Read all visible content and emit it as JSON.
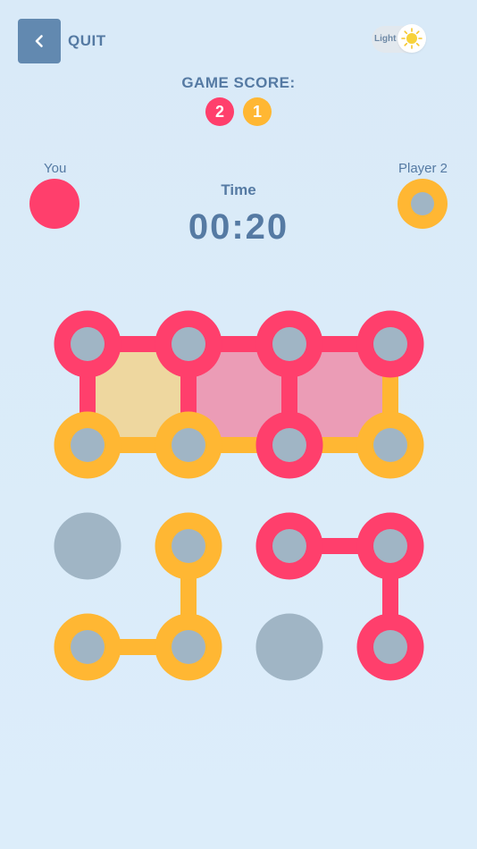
{
  "header": {
    "back_icon": "chevron-left-icon",
    "quit_label": "QUIT",
    "theme_label": "Light",
    "theme_icon": "sun-icon"
  },
  "score": {
    "title": "GAME SCORE:",
    "player1": "2",
    "player2": "1"
  },
  "players": {
    "you": {
      "name": "You",
      "color": "#ff3f6c"
    },
    "opponent": {
      "name": "Player 2",
      "color": "#ffb733"
    }
  },
  "timer": {
    "label": "Time",
    "value": "00:20"
  },
  "colors": {
    "background": "#dcecf9",
    "accent": "#557aa3",
    "player1": "#ff3f6c",
    "player2": "#ffb733",
    "dot_empty": "#a0b5c5",
    "box_player1": "#eb9cb6",
    "box_player2": "#eed79f"
  },
  "board": {
    "rows": 4,
    "cols": 4,
    "dot_owner": [
      [
        "p1",
        "p1",
        "p1",
        "p1"
      ],
      [
        "p2",
        "p2",
        "p1",
        "p2"
      ],
      [
        "none",
        "p2",
        "p1",
        "p1"
      ],
      [
        "p2",
        "p2",
        "none",
        "p1"
      ]
    ],
    "lines": [
      {
        "from": [
          0,
          0
        ],
        "to": [
          0,
          1
        ],
        "owner": "p1"
      },
      {
        "from": [
          0,
          1
        ],
        "to": [
          0,
          2
        ],
        "owner": "p1"
      },
      {
        "from": [
          0,
          2
        ],
        "to": [
          0,
          3
        ],
        "owner": "p1"
      },
      {
        "from": [
          1,
          0
        ],
        "to": [
          1,
          1
        ],
        "owner": "p2"
      },
      {
        "from": [
          1,
          1
        ],
        "to": [
          1,
          2
        ],
        "owner": "p2"
      },
      {
        "from": [
          1,
          2
        ],
        "to": [
          1,
          3
        ],
        "owner": "p2"
      },
      {
        "from": [
          0,
          0
        ],
        "to": [
          1,
          0
        ],
        "owner": "p1"
      },
      {
        "from": [
          0,
          1
        ],
        "to": [
          1,
          1
        ],
        "owner": "p1"
      },
      {
        "from": [
          0,
          2
        ],
        "to": [
          1,
          2
        ],
        "owner": "p1"
      },
      {
        "from": [
          0,
          3
        ],
        "to": [
          1,
          3
        ],
        "owner": "p2"
      },
      {
        "from": [
          2,
          1
        ],
        "to": [
          3,
          1
        ],
        "owner": "p2"
      },
      {
        "from": [
          3,
          0
        ],
        "to": [
          3,
          1
        ],
        "owner": "p2"
      },
      {
        "from": [
          2,
          2
        ],
        "to": [
          2,
          3
        ],
        "owner": "p1"
      },
      {
        "from": [
          2,
          3
        ],
        "to": [
          3,
          3
        ],
        "owner": "p1"
      }
    ],
    "boxes": [
      {
        "cell": [
          0,
          0
        ],
        "owner": "p2"
      },
      {
        "cell": [
          0,
          1
        ],
        "owner": "p1"
      },
      {
        "cell": [
          0,
          2
        ],
        "owner": "p1"
      }
    ]
  }
}
